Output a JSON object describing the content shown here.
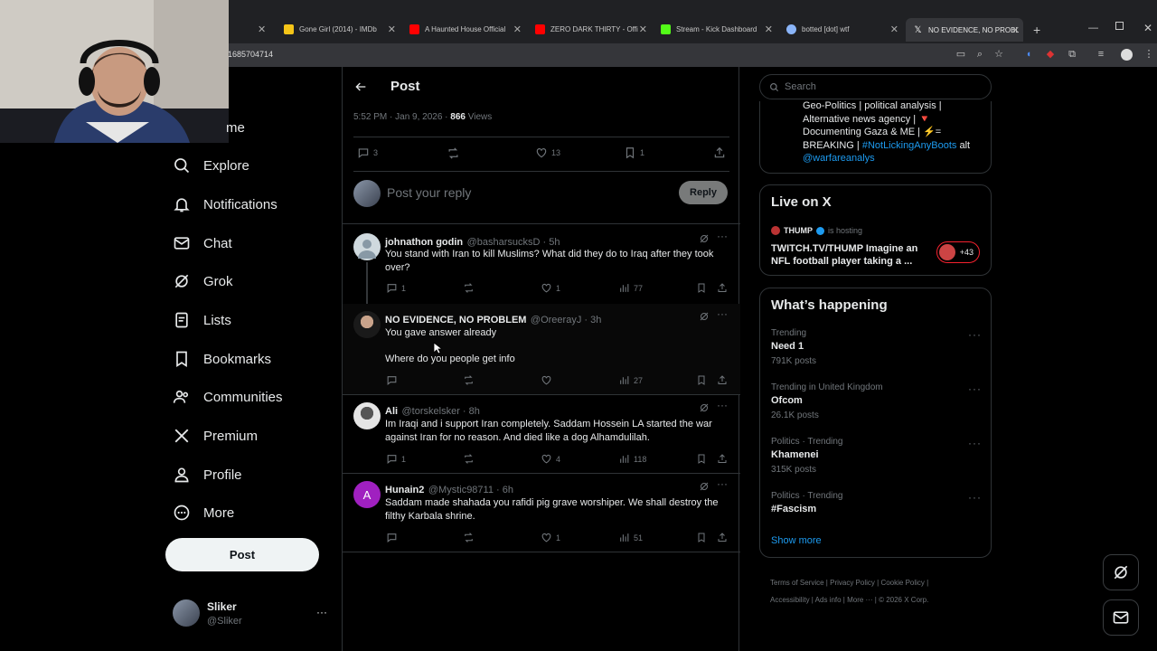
{
  "browser": {
    "tabs": [
      {
        "label": "Gone Girl (2014) - IMDb",
        "fav_color": "#f5c518"
      },
      {
        "label": "A Haunted House Official",
        "fav_color": "#ff0000"
      },
      {
        "label": "ZERO DARK THIRTY - Offi",
        "fav_color": "#ff0000"
      },
      {
        "label": "Stream - Kick Dashboard",
        "fav_color": "#53fc18"
      },
      {
        "label": "botted [dot] wtf",
        "fav_color": "#8ab4f8"
      },
      {
        "label": "NO EVIDENCE, NO PROBL",
        "fav_color": "#ffffff"
      }
    ],
    "url_fragment": "1685704714"
  },
  "nav": {
    "partial_home": "me",
    "items": [
      {
        "label": "Explore",
        "icon": "search-icon"
      },
      {
        "label": "Notifications",
        "icon": "bell-icon"
      },
      {
        "label": "Chat",
        "icon": "mail-icon"
      },
      {
        "label": "Grok",
        "icon": "grok-icon"
      },
      {
        "label": "Lists",
        "icon": "list-icon"
      },
      {
        "label": "Bookmarks",
        "icon": "bookmark-icon"
      },
      {
        "label": "Communities",
        "icon": "people-icon"
      },
      {
        "label": "Premium",
        "icon": "x-logo-icon"
      },
      {
        "label": "Profile",
        "icon": "person-icon"
      },
      {
        "label": "More",
        "icon": "more-circle-icon"
      }
    ],
    "post_label": "Post",
    "account_name": "Sliker",
    "account_handle": "@Sliker"
  },
  "post": {
    "header_title": "Post",
    "timestamp": "5:52 PM · Jan 9, 2026 · ",
    "views_count": "866",
    "views_label": " Views",
    "stats": {
      "replies": "3",
      "reposts": "",
      "likes": "13",
      "bookmarks": "1"
    },
    "reply_placeholder": "Post your reply",
    "reply_button": "Reply"
  },
  "replies": [
    {
      "name": "johnathon godin",
      "handle": "@basharsucksD · 5h",
      "text": "You stand with Iran to kill Muslims? What did they do to Iraq after they took over?",
      "replies": "1",
      "reposts": "",
      "likes": "1",
      "views": "77",
      "avatar": "#cfd9de"
    },
    {
      "name": "NO EVIDENCE, NO PROBLEM",
      "handle": "@OreerayJ · 3h",
      "text": "You gave answer already",
      "text2": "Where do you people get info",
      "replies": "",
      "reposts": "",
      "likes": "",
      "views": "27",
      "avatar": "#444"
    },
    {
      "name": "Ali",
      "handle": "@torskelsker · 8h",
      "text": "Im Iraqi and i support Iran completely. Saddam Hossein LA started the war against Iran for no reason. And died like a dog Alhamdulilah.",
      "replies": "1",
      "reposts": "",
      "likes": "4",
      "views": "118",
      "avatar": "#bbb"
    },
    {
      "name": "Hunain2",
      "handle": "@Mystic98711 · 6h",
      "text": "Saddam made shahada you rafidi pig grave worshiper. We shall destroy the filthy Karbala shrine.",
      "replies": "",
      "reposts": "",
      "likes": "1",
      "views": "51",
      "avatar": "#a020c0",
      "initial": "A"
    }
  ],
  "right": {
    "search_placeholder": "Search",
    "bio_line1": "Geo-Politics | political analysis |",
    "bio_line2": "Alternative news agency | 🔻",
    "bio_line3": "Documenting Gaza & ME | ⚡=",
    "bio_line4_pre": "BREAKING | ",
    "bio_hashtag": "#NotLickingAnyBoots",
    "bio_line4_post": " alt",
    "bio_mention": "@warfareanalys",
    "live_title": "Live on X",
    "live_host": "THUMP",
    "live_hosting": "is hosting",
    "live_text": "TWITCH.TV/THUMP Imagine an NFL football player taking a ...",
    "live_count": "+43",
    "happening_title": "What’s happening",
    "trends": [
      {
        "meta": "Trending",
        "name": "Need 1",
        "count": "791K posts"
      },
      {
        "meta": "Trending in United Kingdom",
        "name": "Ofcom",
        "count": "26.1K posts"
      },
      {
        "meta": "Politics · Trending",
        "name": "Khamenei",
        "count": "315K posts"
      },
      {
        "meta": "Politics · Trending",
        "name": "#Fascism",
        "count": ""
      }
    ],
    "show_more": "Show more",
    "footer": [
      "Terms of Service",
      "Privacy Policy",
      "Cookie Policy",
      "Accessibility",
      "Ads info",
      "More ···",
      "© 2026 X Corp."
    ]
  },
  "colors": {
    "accent": "#1d9bf0",
    "border": "#2f3336",
    "muted": "#71767b"
  }
}
